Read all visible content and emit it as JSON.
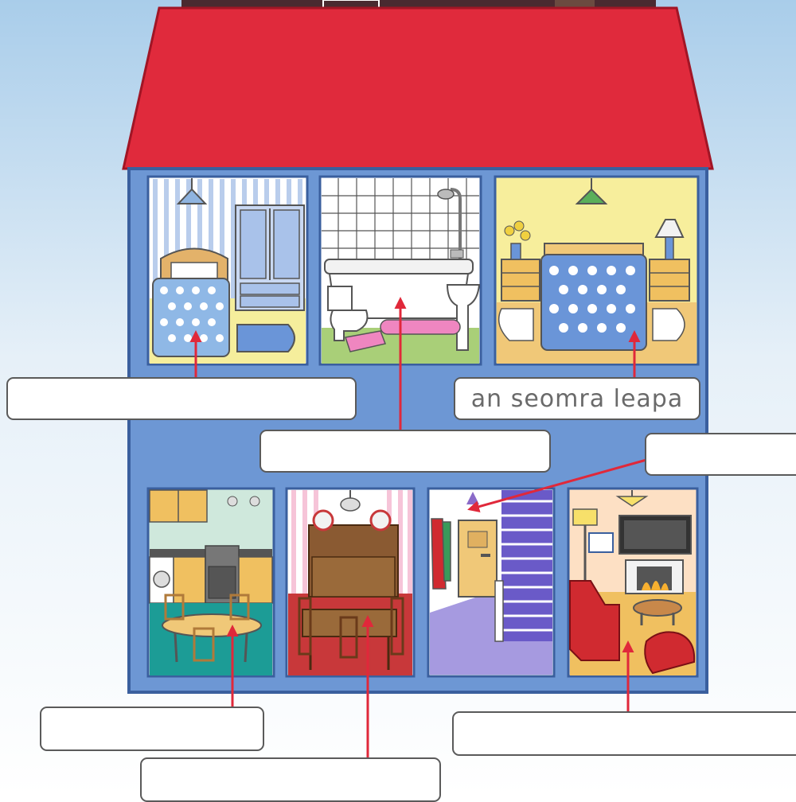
{
  "colors": {
    "sky_top": "#a9cdea",
    "sky_bottom": "#ffffff",
    "roof": "#e02a3c",
    "house_wall": "#6d97d4",
    "room_border": "#3a5f9e",
    "arrow": "#e0283a",
    "chimney": "#4a2a30"
  },
  "labels": {
    "box_1": "",
    "box_2": "",
    "box_3": "an seomra leapa",
    "box_4": "",
    "box_5": "",
    "box_6": "",
    "box_7": ""
  },
  "rooms": [
    "child-bedroom",
    "bathroom",
    "main-bedroom",
    "kitchen",
    "dining-room",
    "hallway",
    "living-room"
  ]
}
